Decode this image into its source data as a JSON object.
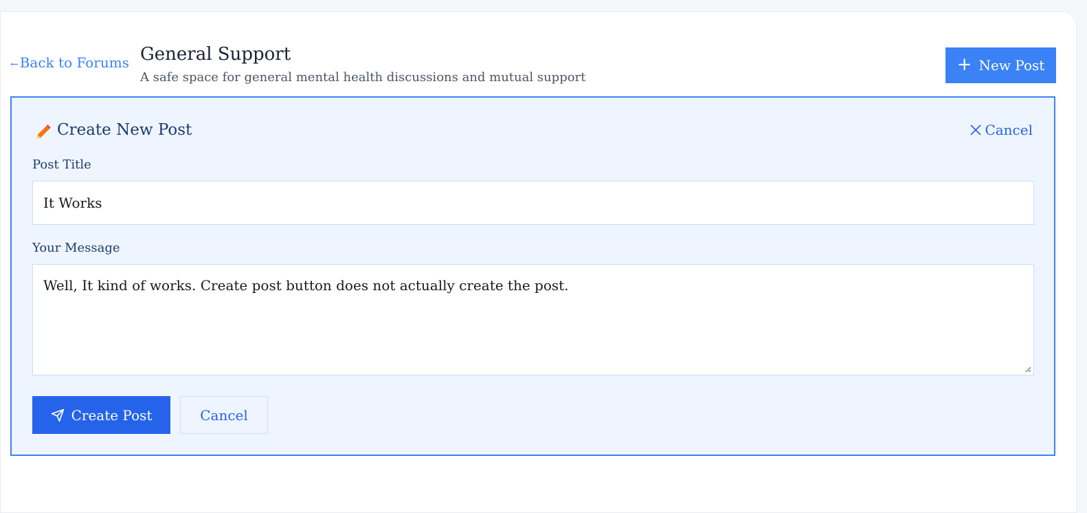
{
  "header": {
    "back_label": "Back to Forums",
    "back_arrow": "←",
    "title": "General Support",
    "subtitle": "A safe space for general mental health discussions and mutual support",
    "new_post_label": "New Post",
    "new_post_icon": "plus-icon"
  },
  "form": {
    "heading": "Create New Post",
    "heading_icon": "pencil-icon",
    "cancel_top_label": "Cancel",
    "title_label": "Post Title",
    "title_value": "It Works",
    "message_label": "Your Message",
    "message_value": "Well, It kind of works. Create post button does not actually create the post.",
    "submit_label": "Create Post",
    "submit_icon": "send-icon",
    "cancel_label": "Cancel"
  },
  "colors": {
    "accent": "#3b82f6",
    "primary_button": "#2563eb",
    "panel_background": "#eef5fe",
    "heading_text": "#1e3a6e",
    "pencil": "#f97316"
  }
}
